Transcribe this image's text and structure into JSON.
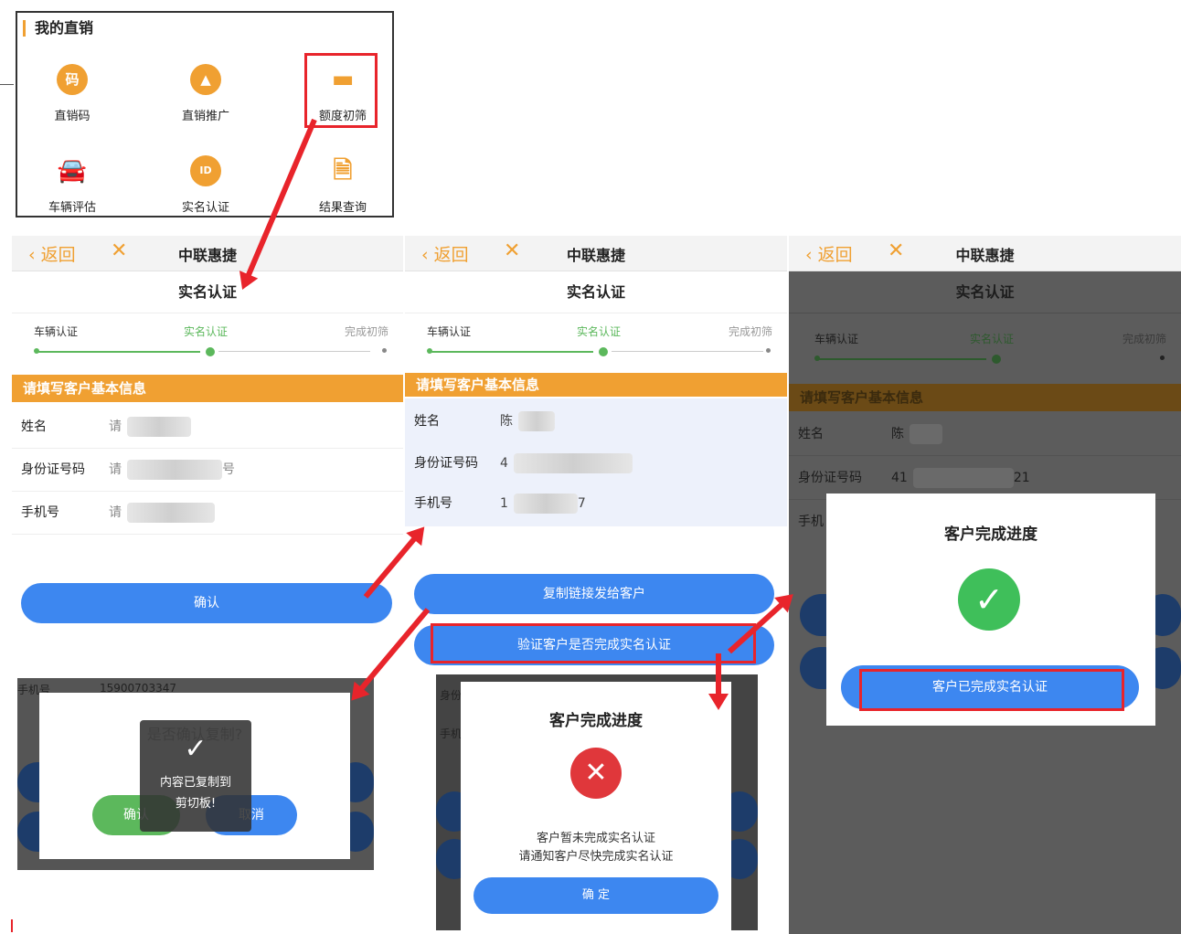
{
  "menu": {
    "header": "我的直销",
    "items": [
      {
        "label": "直销码",
        "glyph": "码"
      },
      {
        "label": "直销推广",
        "glyph": "▲"
      },
      {
        "label": "额度初筛",
        "glyph": "▬"
      },
      {
        "label": "车辆评估",
        "glyph": "🚘"
      },
      {
        "label": "实名认证",
        "glyph": "ID"
      },
      {
        "label": "结果查询",
        "glyph": "🗎"
      }
    ]
  },
  "nav": {
    "back": "返回",
    "close": "✕",
    "title": "中联惠捷"
  },
  "page_subtitle": "实名认证",
  "steps": [
    "车辆认证",
    "实名认证",
    "完成初筛"
  ],
  "section_header": "请填写客户基本信息",
  "fields": {
    "name": "姓名",
    "id": "身份证号码",
    "phone": "手机号"
  },
  "panel1": {
    "name_val": "请",
    "id_val": "请",
    "id_tail": "号",
    "phone_val": "请",
    "confirm": "确认",
    "mini": {
      "phone_label": "手机号",
      "phone_number": "15900703347",
      "dialog_title": "是否确认复制?",
      "ok": "确认",
      "cancel": "取消",
      "toast_check": "✓",
      "toast_text_1": "内容已复制到",
      "toast_text_2": "剪切板!"
    }
  },
  "panel2": {
    "name_val": "陈",
    "id_val": "4",
    "phone_val": "1",
    "phone_tail": "7",
    "copy_button": "复制链接发给客户",
    "verify_button": "验证客户是否完成实名认证",
    "dialog": {
      "title": "客户完成进度",
      "icon": "✕",
      "msg1": "客户暂未完成实名认证",
      "msg2": "请通知客户尽快完成实名认证",
      "ok": "确 定"
    },
    "bg_labels": [
      "身份",
      "手机"
    ]
  },
  "panel3": {
    "name_val": "陈",
    "id_val": "41",
    "id_tail": "21",
    "phone_label_partial": "手机",
    "dialog": {
      "title": "客户完成进度",
      "icon": "✓",
      "button": "客户已完成实名认证"
    }
  },
  "colors": {
    "accent": "#f0a032",
    "primary": "#3d87f0",
    "success": "#5cb85c",
    "error": "#e0373b",
    "highlight": "#e8242b"
  }
}
